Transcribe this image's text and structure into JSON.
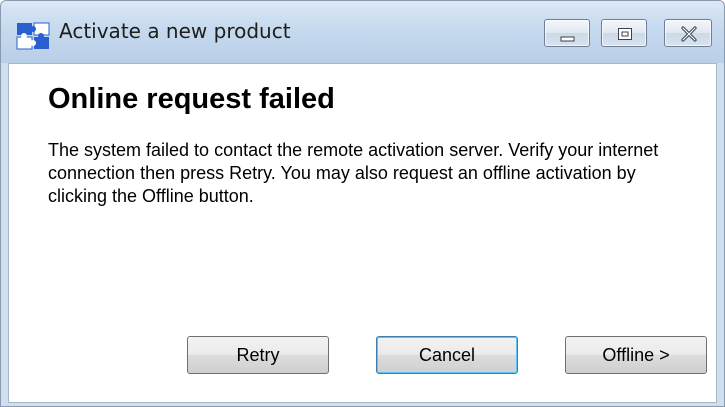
{
  "window": {
    "title": "Activate a new product",
    "app_icon": "puzzle-pieces-icon",
    "controls": {
      "minimize_icon": "minimize-icon",
      "maximize_icon": "maximize-icon",
      "close_icon": "close-icon"
    }
  },
  "content": {
    "heading": "Online request failed",
    "message": "The system failed to contact the remote activation server. Verify your internet connection then press Retry. You may also request an offline activation by clicking the Offline button."
  },
  "buttons": {
    "retry": "Retry",
    "cancel": "Cancel",
    "offline": "Offline >"
  },
  "colors": {
    "titlebar": "#c6d9ee",
    "focus_button_border": "#3c7fb1",
    "icon_blue": "#2a5fd0",
    "icon_white": "#ffffff"
  }
}
